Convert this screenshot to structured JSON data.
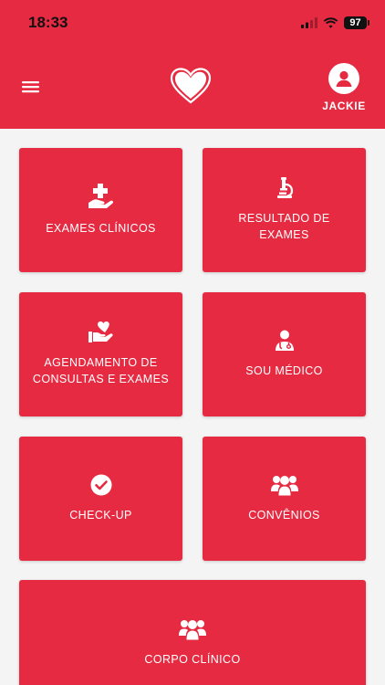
{
  "status_bar": {
    "time": "18:33",
    "battery": "97"
  },
  "header": {
    "menu_icon": "hamburger-menu-icon",
    "logo_icon": "heart-icon",
    "profile": {
      "name": "JACKIE",
      "icon": "user-avatar-icon"
    }
  },
  "colors": {
    "primary": "#e52a41",
    "background": "#f4f4f4",
    "text_on_primary": "#ffffff"
  },
  "menu": [
    {
      "label": "EXAMES CLÍNICOS",
      "icon": "hand-plus-icon"
    },
    {
      "label": "RESULTADO DE\nEXAMES",
      "icon": "microscope-icon"
    },
    {
      "label": "AGENDAMENTO DE\nCONSULTAS E EXAMES",
      "icon": "hand-heart-icon"
    },
    {
      "label": "SOU MÉDICO",
      "icon": "doctor-icon"
    },
    {
      "label": "CHECK-UP",
      "icon": "check-circle-icon"
    },
    {
      "label": "CONVÊNIOS",
      "icon": "users-group-icon"
    },
    {
      "label": "CORPO CLÍNICO",
      "icon": "users-group-icon"
    }
  ]
}
